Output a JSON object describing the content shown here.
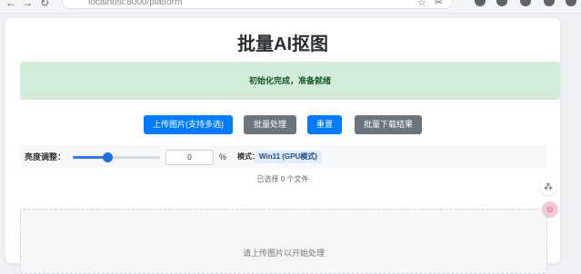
{
  "browser": {
    "url": "localhost:8000/platform",
    "back_glyph": "←",
    "forward_glyph": "→",
    "reload_glyph": "↻",
    "star_glyph": "☆",
    "cut_glyph": "✂"
  },
  "page": {
    "title": "批量AI抠图",
    "status_message": "初始化完成，准备就绪"
  },
  "toolbar": {
    "upload_label": "上传图片(支持多选)",
    "batch_label": "批量处理",
    "reset_label": "重置",
    "download_label": "批量下载结果"
  },
  "controls": {
    "brightness_label": "亮度调整：",
    "brightness_value": "0",
    "brightness_slider_fraction": 0.4,
    "percent_sign": "%",
    "mode_label": "模式：",
    "mode_value": "Win11 (GPU模式)"
  },
  "selection": {
    "count_text": "已选择 0 个文件"
  },
  "dropzone": {
    "hint": "请上传图片以开始处理"
  },
  "floating": {
    "tool_glyph": "⁂",
    "assist_glyph": "☺"
  },
  "colors": {
    "primary": "#007bff",
    "secondary": "#6c757d",
    "success_bg": "#d4edda",
    "success_text": "#155724"
  }
}
